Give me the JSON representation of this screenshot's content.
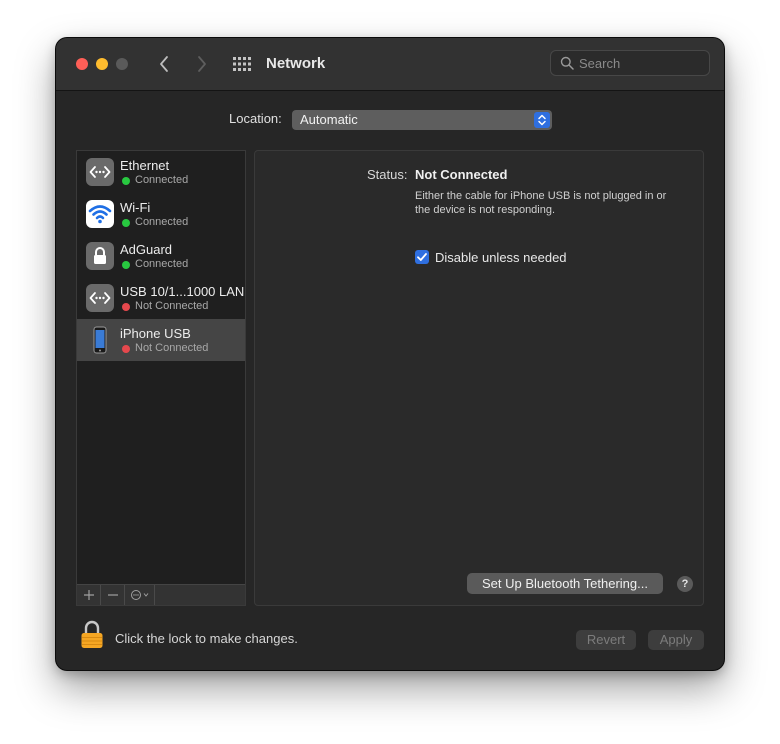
{
  "window": {
    "title": "Network",
    "search_placeholder": "Search"
  },
  "location": {
    "label": "Location:",
    "value": "Automatic"
  },
  "services": [
    {
      "name": "Ethernet",
      "status": "Connected",
      "status_color": "#28c840",
      "icon": "ethernet-icon",
      "selected": false
    },
    {
      "name": "Wi-Fi",
      "status": "Connected",
      "status_color": "#28c840",
      "icon": "wifi-icon",
      "selected": false
    },
    {
      "name": "AdGuard",
      "status": "Connected",
      "status_color": "#28c840",
      "icon": "lock-vpn-icon",
      "selected": false
    },
    {
      "name": "USB 10/1...1000 LAN",
      "status": "Not Connected",
      "status_color": "#e5484d",
      "icon": "ethernet-icon",
      "selected": false
    },
    {
      "name": "iPhone USB",
      "status": "Not Connected",
      "status_color": "#e5484d",
      "icon": "iphone-icon",
      "selected": true
    }
  ],
  "detail": {
    "status_label": "Status:",
    "status_value": "Not Connected",
    "status_description": "Either the cable for iPhone USB is not plugged in or the device is not responding.",
    "checkbox_label": "Disable unless needed",
    "checkbox_checked": true,
    "bluetooth_button": "Set Up Bluetooth Tethering...",
    "help_label": "?"
  },
  "footer": {
    "lock_text": "Click the lock to make changes.",
    "revert_label": "Revert",
    "apply_label": "Apply"
  },
  "colors": {
    "accent": "#2f6fe0",
    "connected": "#28c840",
    "not_connected": "#e5484d",
    "lock": "#f5a623"
  }
}
